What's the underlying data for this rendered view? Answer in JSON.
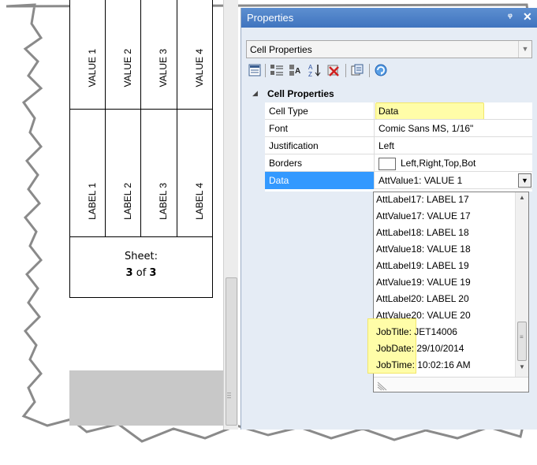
{
  "sheet": {
    "value_labels": [
      "VALUE 1",
      "VALUE 2",
      "VALUE 3",
      "VALUE 4"
    ],
    "label_labels": [
      "LABEL 1",
      "LABEL 2",
      "LABEL 3",
      "LABEL 4"
    ],
    "sheet_label": "Sheet:",
    "sheet_current": "3",
    "sheet_of": "of",
    "sheet_total": "3"
  },
  "panel": {
    "title": "Properties",
    "pin_glyph": "ᵠ",
    "close_glyph": "✕",
    "object_selector": "Cell Properties",
    "toolbar_icons": [
      "property-pages-icon",
      "categorized-icon",
      "show-used-icon",
      "sort-alphabetical-icon",
      "clear-icon",
      "copy-format-icon",
      "refresh-icon"
    ],
    "category": "Cell Properties",
    "rows": [
      {
        "name": "Cell Type",
        "value": "Data"
      },
      {
        "name": "Font",
        "value": "Comic Sans MS, 1/16\""
      },
      {
        "name": "Justification",
        "value": "Left"
      },
      {
        "name": "Borders",
        "value": "Left,Right,Top,Bot"
      },
      {
        "name": "Data",
        "value": "AttValue1: VALUE 1"
      }
    ],
    "dropdown_items": [
      "AttLabel17: LABEL 17",
      "AttValue17: VALUE 17",
      "AttLabel18: LABEL 18",
      "AttValue18: VALUE 18",
      "AttLabel19: LABEL 19",
      "AttValue19: VALUE 19",
      "AttLabel20: LABEL 20",
      "AttValue20: VALUE 20",
      "JobTitle: JET14006",
      "JobDate: 29/10/2014",
      "JobTime: 10:02:16 AM"
    ]
  },
  "colors": {
    "titlebar": "#4a7fc6",
    "selection": "#3399ff",
    "highlight": "#fffda8",
    "panel_bg": "#e5ecf5"
  }
}
